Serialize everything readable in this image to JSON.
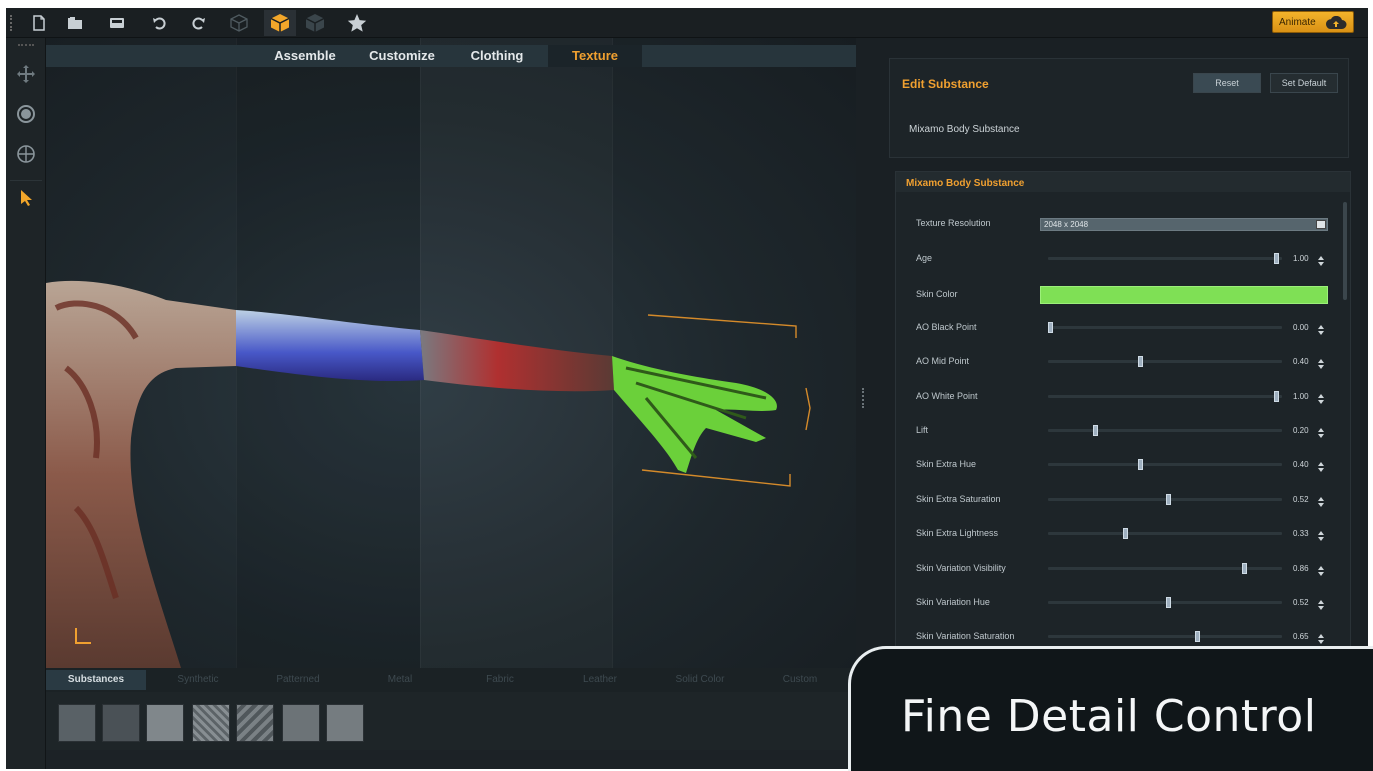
{
  "toolbar": {
    "buttons": [
      {
        "name": "new-file-icon"
      },
      {
        "name": "open-folder-icon"
      },
      {
        "name": "save-icon"
      },
      {
        "name": "undo-icon"
      },
      {
        "name": "redo-icon"
      },
      {
        "name": "wireframe-cube-icon"
      },
      {
        "name": "textured-cube-icon"
      },
      {
        "name": "shaded-cube-icon"
      },
      {
        "name": "star-icon"
      }
    ],
    "animate_label": "Animate"
  },
  "tools": [
    {
      "name": "move-icon"
    },
    {
      "name": "rotate-icon"
    },
    {
      "name": "target-icon"
    },
    {
      "name": "select-arrow-icon"
    }
  ],
  "tabs": [
    {
      "label": "Assemble",
      "active": false
    },
    {
      "label": "Customize",
      "active": false
    },
    {
      "label": "Clothing",
      "active": false
    },
    {
      "label": "Texture",
      "active": true
    }
  ],
  "edit_substance": {
    "title": "Edit Substance",
    "reset_label": "Reset",
    "default_label": "Set Default",
    "name": "Mixamo Body Substance"
  },
  "params_panel": {
    "title": "Mixamo Body Substance",
    "resolution_label": "Texture Resolution",
    "resolution_value": "2048 x 2048",
    "skin_color_label": "Skin Color",
    "skin_color": "#7fe055",
    "sliders": [
      {
        "label": "Age",
        "value": "1.00",
        "level": 1.0
      },
      {
        "label": "AO Black Point",
        "value": "0.00",
        "level": 0.0
      },
      {
        "label": "AO Mid Point",
        "value": "0.40",
        "level": 0.4
      },
      {
        "label": "AO White Point",
        "value": "1.00",
        "level": 1.0
      },
      {
        "label": "Lift",
        "value": "0.20",
        "level": 0.2
      },
      {
        "label": "Skin Extra Hue",
        "value": "0.40",
        "level": 0.4
      },
      {
        "label": "Skin Extra Saturation",
        "value": "0.52",
        "level": 0.52
      },
      {
        "label": "Skin Extra Lightness",
        "value": "0.33",
        "level": 0.33
      },
      {
        "label": "Skin Variation Visibility",
        "value": "0.86",
        "level": 0.86
      },
      {
        "label": "Skin Variation Hue",
        "value": "0.52",
        "level": 0.52
      },
      {
        "label": "Skin Variation Saturation",
        "value": "0.65",
        "level": 0.65
      }
    ]
  },
  "material_tabs": [
    {
      "label": "Substances",
      "active": true
    },
    {
      "label": "Synthetic",
      "active": false
    },
    {
      "label": "Patterned",
      "active": false
    },
    {
      "label": "Metal",
      "active": false
    },
    {
      "label": "Fabric",
      "active": false
    },
    {
      "label": "Leather",
      "active": false
    },
    {
      "label": "Solid Color",
      "active": false
    },
    {
      "label": "Custom",
      "active": false
    }
  ],
  "banner": {
    "text": "Fine Detail Control"
  },
  "colors": {
    "accent": "#f0a030",
    "skin": "#7fe055"
  }
}
